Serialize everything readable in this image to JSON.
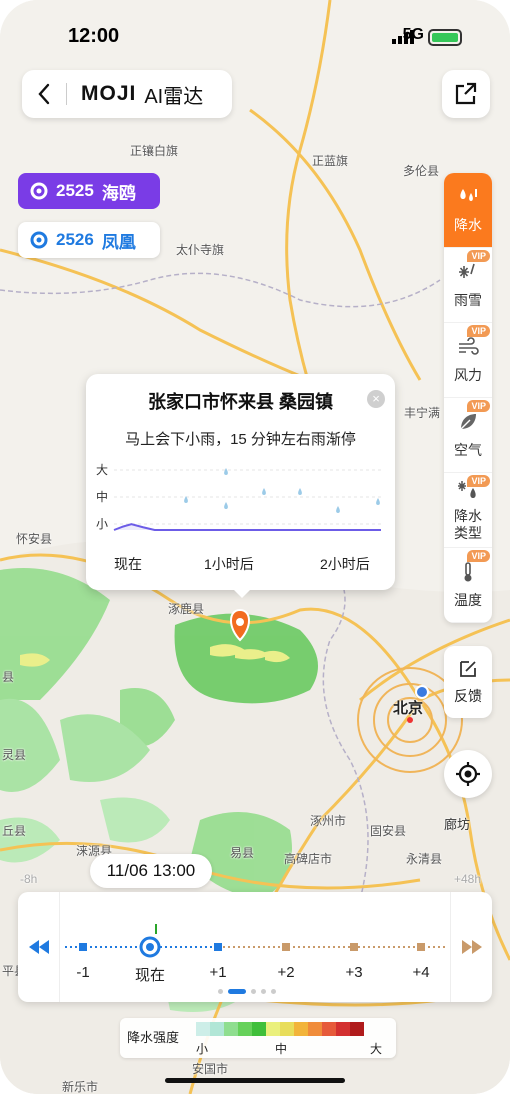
{
  "status": {
    "time": "12:00",
    "network": "5G"
  },
  "header": {
    "brand": "MOJI",
    "title": "AI雷达"
  },
  "typhoons": [
    {
      "number": "2525",
      "name": "海鸥"
    },
    {
      "number": "2526",
      "name": "凤凰"
    }
  ],
  "layers": [
    {
      "label": "降水",
      "vip": "",
      "active": true
    },
    {
      "label": "雨雪",
      "vip": "VIP"
    },
    {
      "label": "风力",
      "vip": "VIP"
    },
    {
      "label": "空气",
      "vip": "VIP"
    },
    {
      "label_line1": "降水",
      "label_line2": "类型",
      "vip": "VIP"
    },
    {
      "label": "温度",
      "vip": "VIP"
    }
  ],
  "feedback_label": "反馈",
  "popup": {
    "location": "张家口市怀来县 桑园镇",
    "forecast": "马上会下小雨，15 分钟左右雨渐停",
    "levels": [
      "大",
      "中",
      "小"
    ],
    "x_ticks": [
      "现在",
      "1小时后",
      "2小时后"
    ]
  },
  "chart_data": {
    "type": "area",
    "title": "马上会下小雨，15 分钟左右雨渐停",
    "y_categories": [
      "小",
      "中",
      "大"
    ],
    "x_ticks": [
      "现在",
      "1小时后",
      "2小时后"
    ],
    "x_unit": "hours",
    "series": [
      {
        "x": [
          0,
          0.08,
          0.15,
          0.25,
          0.35,
          0.5,
          1.0,
          1.5,
          2.0,
          2.3
        ],
        "y": [
          0.0,
          0.45,
          0.75,
          0.35,
          0.0,
          0.0,
          0.0,
          0.0,
          0.0,
          0.0
        ]
      }
    ],
    "grid": true
  },
  "time_chip": "11/06 13:00",
  "timeline": {
    "labels": [
      "-1",
      "现在",
      "+1",
      "+2",
      "+3",
      "+4"
    ],
    "current_index": 1
  },
  "legend": {
    "title": "降水强度",
    "low": "小",
    "mid": "中",
    "high": "大",
    "colors": [
      "#cdeee8",
      "#b1e6d6",
      "#8fde8f",
      "#66d15a",
      "#3fbf3a",
      "#eaf07c",
      "#e8dd5a",
      "#f2b43a",
      "#f08c3a",
      "#e65a3a",
      "#d33030",
      "#b01b1b"
    ]
  },
  "map": {
    "labels": [
      {
        "name": "正镶白旗"
      },
      {
        "name": "正蓝旗"
      },
      {
        "name": "多伦县"
      },
      {
        "name": "太仆寺旗"
      },
      {
        "name": "丰宁满"
      },
      {
        "name": "怀安县"
      },
      {
        "name": "涿鹿县"
      },
      {
        "name": "北京"
      },
      {
        "name": "灵县"
      },
      {
        "name": "涿州市"
      },
      {
        "name": "固安县"
      },
      {
        "name": "廊坊"
      },
      {
        "name": "丘县"
      },
      {
        "name": "涞源县"
      },
      {
        "name": "易县"
      },
      {
        "name": "高碑店市"
      },
      {
        "name": "永清县"
      },
      {
        "name": "平县"
      },
      {
        "name": "安国市"
      },
      {
        "name": "新乐市"
      },
      {
        "name": "县"
      },
      {
        "name": "-8h"
      },
      {
        "name": "+48h"
      }
    ]
  }
}
